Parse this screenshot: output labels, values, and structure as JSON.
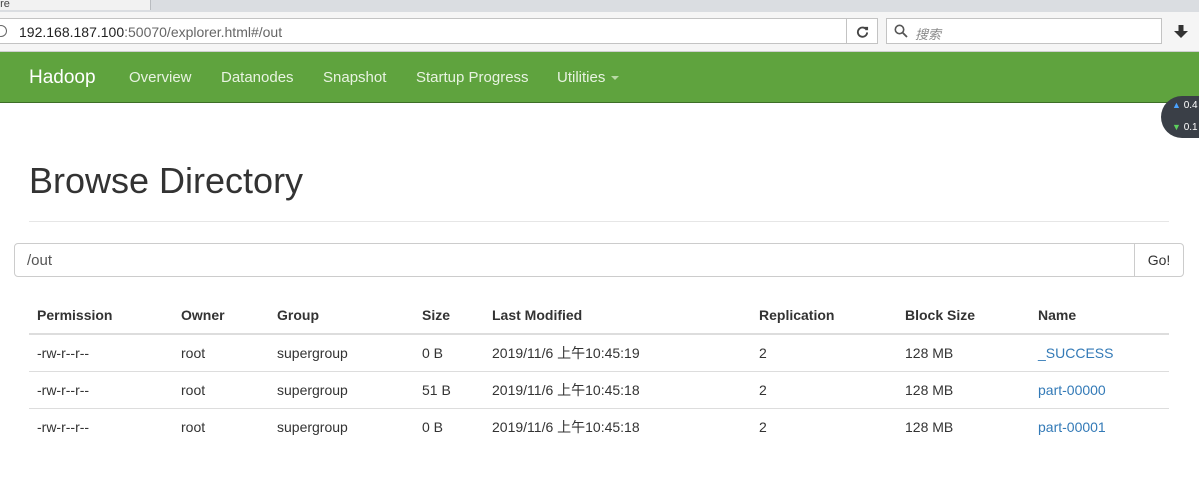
{
  "browser": {
    "tab_title": "ore",
    "url_host": "192.168.187.100",
    "url_rest": ":50070/explorer.html#/out",
    "search_placeholder": "搜索"
  },
  "navbar": {
    "brand": "Hadoop",
    "items": [
      {
        "label": "Overview"
      },
      {
        "label": "Datanodes"
      },
      {
        "label": "Snapshot"
      },
      {
        "label": "Startup Progress"
      },
      {
        "label": "Utilities"
      }
    ]
  },
  "net_speed": {
    "up": "0.4",
    "down": "0.1"
  },
  "page": {
    "title": "Browse Directory",
    "path_value": "/out",
    "go_label": "Go!"
  },
  "table": {
    "headers": [
      "Permission",
      "Owner",
      "Group",
      "Size",
      "Last Modified",
      "Replication",
      "Block Size",
      "Name"
    ],
    "rows": [
      {
        "permission": "-rw-r--r--",
        "owner": "root",
        "group": "supergroup",
        "size": "0 B",
        "modified": "2019/11/6 上午10:45:19",
        "replication": "2",
        "block_size": "128 MB",
        "name": "_SUCCESS"
      },
      {
        "permission": "-rw-r--r--",
        "owner": "root",
        "group": "supergroup",
        "size": "51 B",
        "modified": "2019/11/6 上午10:45:18",
        "replication": "2",
        "block_size": "128 MB",
        "name": "part-00000"
      },
      {
        "permission": "-rw-r--r--",
        "owner": "root",
        "group": "supergroup",
        "size": "0 B",
        "modified": "2019/11/6 上午10:45:18",
        "replication": "2",
        "block_size": "128 MB",
        "name": "part-00001"
      }
    ]
  },
  "colors": {
    "navbar": "#5fa33e",
    "link": "#337ab7"
  }
}
